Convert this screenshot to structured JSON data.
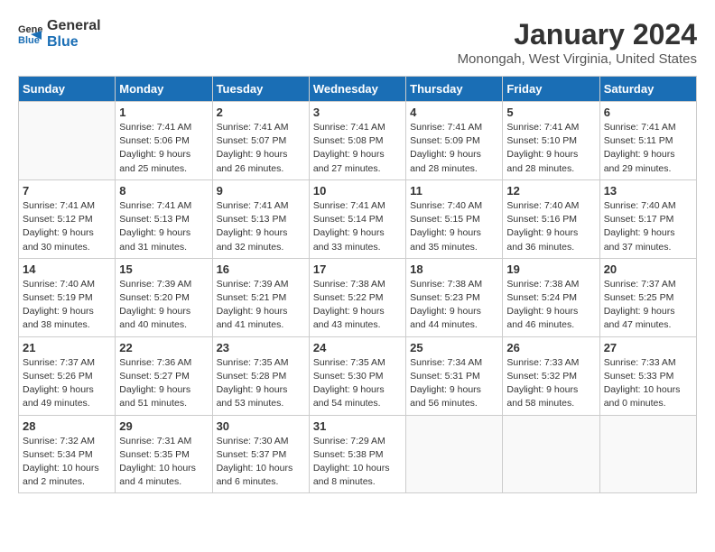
{
  "logo": {
    "general": "General",
    "blue": "Blue"
  },
  "title": "January 2024",
  "subtitle": "Monongah, West Virginia, United States",
  "headers": [
    "Sunday",
    "Monday",
    "Tuesday",
    "Wednesday",
    "Thursday",
    "Friday",
    "Saturday"
  ],
  "weeks": [
    [
      {
        "day": "",
        "sunrise": "",
        "sunset": "",
        "daylight": ""
      },
      {
        "day": "1",
        "sunrise": "Sunrise: 7:41 AM",
        "sunset": "Sunset: 5:06 PM",
        "daylight": "Daylight: 9 hours and 25 minutes."
      },
      {
        "day": "2",
        "sunrise": "Sunrise: 7:41 AM",
        "sunset": "Sunset: 5:07 PM",
        "daylight": "Daylight: 9 hours and 26 minutes."
      },
      {
        "day": "3",
        "sunrise": "Sunrise: 7:41 AM",
        "sunset": "Sunset: 5:08 PM",
        "daylight": "Daylight: 9 hours and 27 minutes."
      },
      {
        "day": "4",
        "sunrise": "Sunrise: 7:41 AM",
        "sunset": "Sunset: 5:09 PM",
        "daylight": "Daylight: 9 hours and 28 minutes."
      },
      {
        "day": "5",
        "sunrise": "Sunrise: 7:41 AM",
        "sunset": "Sunset: 5:10 PM",
        "daylight": "Daylight: 9 hours and 28 minutes."
      },
      {
        "day": "6",
        "sunrise": "Sunrise: 7:41 AM",
        "sunset": "Sunset: 5:11 PM",
        "daylight": "Daylight: 9 hours and 29 minutes."
      }
    ],
    [
      {
        "day": "7",
        "sunrise": "Sunrise: 7:41 AM",
        "sunset": "Sunset: 5:12 PM",
        "daylight": "Daylight: 9 hours and 30 minutes."
      },
      {
        "day": "8",
        "sunrise": "Sunrise: 7:41 AM",
        "sunset": "Sunset: 5:13 PM",
        "daylight": "Daylight: 9 hours and 31 minutes."
      },
      {
        "day": "9",
        "sunrise": "Sunrise: 7:41 AM",
        "sunset": "Sunset: 5:13 PM",
        "daylight": "Daylight: 9 hours and 32 minutes."
      },
      {
        "day": "10",
        "sunrise": "Sunrise: 7:41 AM",
        "sunset": "Sunset: 5:14 PM",
        "daylight": "Daylight: 9 hours and 33 minutes."
      },
      {
        "day": "11",
        "sunrise": "Sunrise: 7:40 AM",
        "sunset": "Sunset: 5:15 PM",
        "daylight": "Daylight: 9 hours and 35 minutes."
      },
      {
        "day": "12",
        "sunrise": "Sunrise: 7:40 AM",
        "sunset": "Sunset: 5:16 PM",
        "daylight": "Daylight: 9 hours and 36 minutes."
      },
      {
        "day": "13",
        "sunrise": "Sunrise: 7:40 AM",
        "sunset": "Sunset: 5:17 PM",
        "daylight": "Daylight: 9 hours and 37 minutes."
      }
    ],
    [
      {
        "day": "14",
        "sunrise": "Sunrise: 7:40 AM",
        "sunset": "Sunset: 5:19 PM",
        "daylight": "Daylight: 9 hours and 38 minutes."
      },
      {
        "day": "15",
        "sunrise": "Sunrise: 7:39 AM",
        "sunset": "Sunset: 5:20 PM",
        "daylight": "Daylight: 9 hours and 40 minutes."
      },
      {
        "day": "16",
        "sunrise": "Sunrise: 7:39 AM",
        "sunset": "Sunset: 5:21 PM",
        "daylight": "Daylight: 9 hours and 41 minutes."
      },
      {
        "day": "17",
        "sunrise": "Sunrise: 7:38 AM",
        "sunset": "Sunset: 5:22 PM",
        "daylight": "Daylight: 9 hours and 43 minutes."
      },
      {
        "day": "18",
        "sunrise": "Sunrise: 7:38 AM",
        "sunset": "Sunset: 5:23 PM",
        "daylight": "Daylight: 9 hours and 44 minutes."
      },
      {
        "day": "19",
        "sunrise": "Sunrise: 7:38 AM",
        "sunset": "Sunset: 5:24 PM",
        "daylight": "Daylight: 9 hours and 46 minutes."
      },
      {
        "day": "20",
        "sunrise": "Sunrise: 7:37 AM",
        "sunset": "Sunset: 5:25 PM",
        "daylight": "Daylight: 9 hours and 47 minutes."
      }
    ],
    [
      {
        "day": "21",
        "sunrise": "Sunrise: 7:37 AM",
        "sunset": "Sunset: 5:26 PM",
        "daylight": "Daylight: 9 hours and 49 minutes."
      },
      {
        "day": "22",
        "sunrise": "Sunrise: 7:36 AM",
        "sunset": "Sunset: 5:27 PM",
        "daylight": "Daylight: 9 hours and 51 minutes."
      },
      {
        "day": "23",
        "sunrise": "Sunrise: 7:35 AM",
        "sunset": "Sunset: 5:28 PM",
        "daylight": "Daylight: 9 hours and 53 minutes."
      },
      {
        "day": "24",
        "sunrise": "Sunrise: 7:35 AM",
        "sunset": "Sunset: 5:30 PM",
        "daylight": "Daylight: 9 hours and 54 minutes."
      },
      {
        "day": "25",
        "sunrise": "Sunrise: 7:34 AM",
        "sunset": "Sunset: 5:31 PM",
        "daylight": "Daylight: 9 hours and 56 minutes."
      },
      {
        "day": "26",
        "sunrise": "Sunrise: 7:33 AM",
        "sunset": "Sunset: 5:32 PM",
        "daylight": "Daylight: 9 hours and 58 minutes."
      },
      {
        "day": "27",
        "sunrise": "Sunrise: 7:33 AM",
        "sunset": "Sunset: 5:33 PM",
        "daylight": "Daylight: 10 hours and 0 minutes."
      }
    ],
    [
      {
        "day": "28",
        "sunrise": "Sunrise: 7:32 AM",
        "sunset": "Sunset: 5:34 PM",
        "daylight": "Daylight: 10 hours and 2 minutes."
      },
      {
        "day": "29",
        "sunrise": "Sunrise: 7:31 AM",
        "sunset": "Sunset: 5:35 PM",
        "daylight": "Daylight: 10 hours and 4 minutes."
      },
      {
        "day": "30",
        "sunrise": "Sunrise: 7:30 AM",
        "sunset": "Sunset: 5:37 PM",
        "daylight": "Daylight: 10 hours and 6 minutes."
      },
      {
        "day": "31",
        "sunrise": "Sunrise: 7:29 AM",
        "sunset": "Sunset: 5:38 PM",
        "daylight": "Daylight: 10 hours and 8 minutes."
      },
      {
        "day": "",
        "sunrise": "",
        "sunset": "",
        "daylight": ""
      },
      {
        "day": "",
        "sunrise": "",
        "sunset": "",
        "daylight": ""
      },
      {
        "day": "",
        "sunrise": "",
        "sunset": "",
        "daylight": ""
      }
    ]
  ]
}
